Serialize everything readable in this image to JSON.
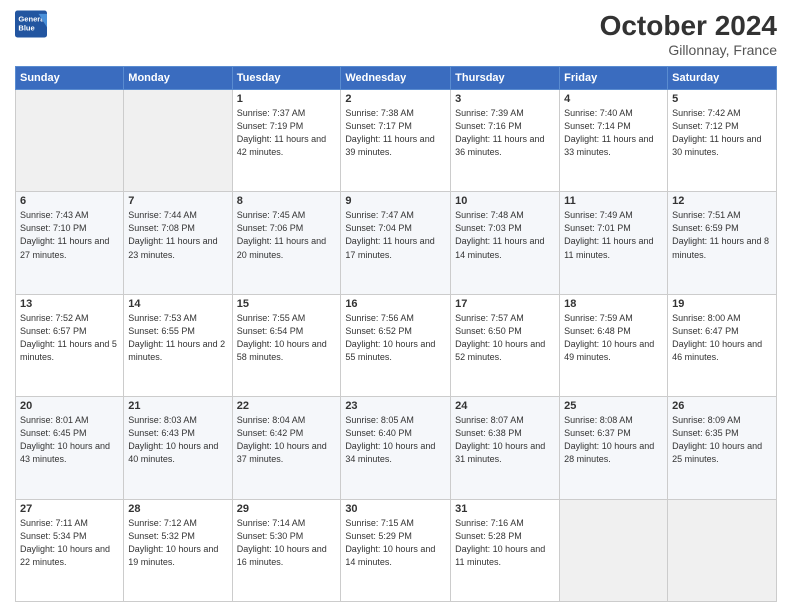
{
  "header": {
    "logo_line1": "General",
    "logo_line2": "Blue",
    "month": "October 2024",
    "location": "Gillonnay, France"
  },
  "weekdays": [
    "Sunday",
    "Monday",
    "Tuesday",
    "Wednesday",
    "Thursday",
    "Friday",
    "Saturday"
  ],
  "weeks": [
    [
      {
        "day": "",
        "info": ""
      },
      {
        "day": "",
        "info": ""
      },
      {
        "day": "1",
        "info": "Sunrise: 7:37 AM\nSunset: 7:19 PM\nDaylight: 11 hours and 42 minutes."
      },
      {
        "day": "2",
        "info": "Sunrise: 7:38 AM\nSunset: 7:17 PM\nDaylight: 11 hours and 39 minutes."
      },
      {
        "day": "3",
        "info": "Sunrise: 7:39 AM\nSunset: 7:16 PM\nDaylight: 11 hours and 36 minutes."
      },
      {
        "day": "4",
        "info": "Sunrise: 7:40 AM\nSunset: 7:14 PM\nDaylight: 11 hours and 33 minutes."
      },
      {
        "day": "5",
        "info": "Sunrise: 7:42 AM\nSunset: 7:12 PM\nDaylight: 11 hours and 30 minutes."
      }
    ],
    [
      {
        "day": "6",
        "info": "Sunrise: 7:43 AM\nSunset: 7:10 PM\nDaylight: 11 hours and 27 minutes."
      },
      {
        "day": "7",
        "info": "Sunrise: 7:44 AM\nSunset: 7:08 PM\nDaylight: 11 hours and 23 minutes."
      },
      {
        "day": "8",
        "info": "Sunrise: 7:45 AM\nSunset: 7:06 PM\nDaylight: 11 hours and 20 minutes."
      },
      {
        "day": "9",
        "info": "Sunrise: 7:47 AM\nSunset: 7:04 PM\nDaylight: 11 hours and 17 minutes."
      },
      {
        "day": "10",
        "info": "Sunrise: 7:48 AM\nSunset: 7:03 PM\nDaylight: 11 hours and 14 minutes."
      },
      {
        "day": "11",
        "info": "Sunrise: 7:49 AM\nSunset: 7:01 PM\nDaylight: 11 hours and 11 minutes."
      },
      {
        "day": "12",
        "info": "Sunrise: 7:51 AM\nSunset: 6:59 PM\nDaylight: 11 hours and 8 minutes."
      }
    ],
    [
      {
        "day": "13",
        "info": "Sunrise: 7:52 AM\nSunset: 6:57 PM\nDaylight: 11 hours and 5 minutes."
      },
      {
        "day": "14",
        "info": "Sunrise: 7:53 AM\nSunset: 6:55 PM\nDaylight: 11 hours and 2 minutes."
      },
      {
        "day": "15",
        "info": "Sunrise: 7:55 AM\nSunset: 6:54 PM\nDaylight: 10 hours and 58 minutes."
      },
      {
        "day": "16",
        "info": "Sunrise: 7:56 AM\nSunset: 6:52 PM\nDaylight: 10 hours and 55 minutes."
      },
      {
        "day": "17",
        "info": "Sunrise: 7:57 AM\nSunset: 6:50 PM\nDaylight: 10 hours and 52 minutes."
      },
      {
        "day": "18",
        "info": "Sunrise: 7:59 AM\nSunset: 6:48 PM\nDaylight: 10 hours and 49 minutes."
      },
      {
        "day": "19",
        "info": "Sunrise: 8:00 AM\nSunset: 6:47 PM\nDaylight: 10 hours and 46 minutes."
      }
    ],
    [
      {
        "day": "20",
        "info": "Sunrise: 8:01 AM\nSunset: 6:45 PM\nDaylight: 10 hours and 43 minutes."
      },
      {
        "day": "21",
        "info": "Sunrise: 8:03 AM\nSunset: 6:43 PM\nDaylight: 10 hours and 40 minutes."
      },
      {
        "day": "22",
        "info": "Sunrise: 8:04 AM\nSunset: 6:42 PM\nDaylight: 10 hours and 37 minutes."
      },
      {
        "day": "23",
        "info": "Sunrise: 8:05 AM\nSunset: 6:40 PM\nDaylight: 10 hours and 34 minutes."
      },
      {
        "day": "24",
        "info": "Sunrise: 8:07 AM\nSunset: 6:38 PM\nDaylight: 10 hours and 31 minutes."
      },
      {
        "day": "25",
        "info": "Sunrise: 8:08 AM\nSunset: 6:37 PM\nDaylight: 10 hours and 28 minutes."
      },
      {
        "day": "26",
        "info": "Sunrise: 8:09 AM\nSunset: 6:35 PM\nDaylight: 10 hours and 25 minutes."
      }
    ],
    [
      {
        "day": "27",
        "info": "Sunrise: 7:11 AM\nSunset: 5:34 PM\nDaylight: 10 hours and 22 minutes."
      },
      {
        "day": "28",
        "info": "Sunrise: 7:12 AM\nSunset: 5:32 PM\nDaylight: 10 hours and 19 minutes."
      },
      {
        "day": "29",
        "info": "Sunrise: 7:14 AM\nSunset: 5:30 PM\nDaylight: 10 hours and 16 minutes."
      },
      {
        "day": "30",
        "info": "Sunrise: 7:15 AM\nSunset: 5:29 PM\nDaylight: 10 hours and 14 minutes."
      },
      {
        "day": "31",
        "info": "Sunrise: 7:16 AM\nSunset: 5:28 PM\nDaylight: 10 hours and 11 minutes."
      },
      {
        "day": "",
        "info": ""
      },
      {
        "day": "",
        "info": ""
      }
    ]
  ]
}
